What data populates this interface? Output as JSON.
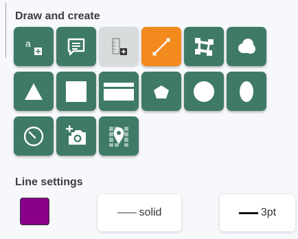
{
  "draw_section": {
    "heading": "Draw and create",
    "tools": [
      {
        "name": "text-tool",
        "label": "a",
        "icon": "text-add-icon",
        "state": "normal"
      },
      {
        "name": "comment-tool",
        "icon": "comment-icon",
        "state": "normal"
      },
      {
        "name": "ruler-tool",
        "icon": "ruler-add-icon",
        "state": "disabled"
      },
      {
        "name": "line-tool",
        "icon": "line-icon",
        "state": "active"
      },
      {
        "name": "rectangle-handles-tool",
        "icon": "vertex-square-icon",
        "state": "normal"
      },
      {
        "name": "cloud-tool",
        "icon": "cloud-icon",
        "state": "normal"
      },
      {
        "name": "triangle-tool",
        "icon": "triangle-icon",
        "state": "normal"
      },
      {
        "name": "square-tool",
        "icon": "square-icon",
        "state": "normal"
      },
      {
        "name": "wide-rectangle-tool",
        "icon": "wide-rectangle-icon",
        "state": "normal"
      },
      {
        "name": "pentagon-tool",
        "icon": "pentagon-icon",
        "state": "normal"
      },
      {
        "name": "circle-tool",
        "icon": "circle-icon",
        "state": "normal"
      },
      {
        "name": "ellipse-tool",
        "icon": "ellipse-icon",
        "state": "normal"
      },
      {
        "name": "gauge-tool",
        "icon": "gauge-icon",
        "state": "normal"
      },
      {
        "name": "add-photo-tool",
        "icon": "add-photo-icon",
        "state": "normal"
      },
      {
        "name": "map-pin-tool",
        "icon": "map-pin-icon",
        "state": "normal"
      }
    ]
  },
  "line_settings": {
    "heading": "Line settings",
    "color": "#8b008b",
    "style_label": "solid",
    "width_label": "3pt"
  },
  "colors": {
    "tool_green": "#3e7a65",
    "tool_active_orange": "#f28a1e",
    "tool_disabled_gray": "#d8dbdc"
  }
}
